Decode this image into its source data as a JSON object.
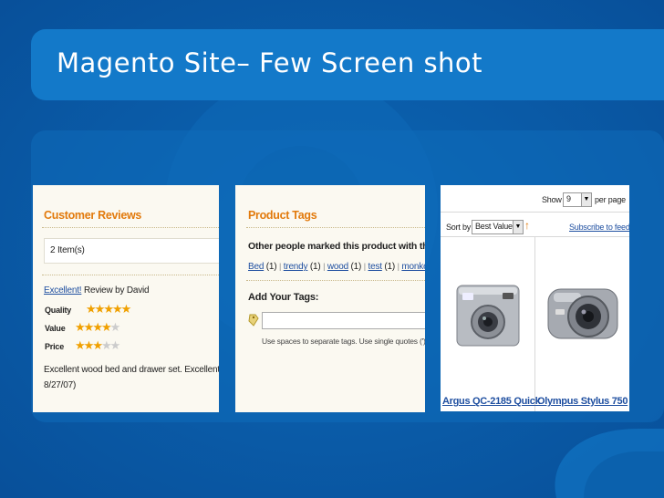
{
  "slide": {
    "title": "Magento Site– Few Screen shot",
    "colors": {
      "background": "#0a5ea8",
      "band": "#1379c9",
      "accent": "#e27a0c",
      "link": "#1f4fa0",
      "star": "#f0a000"
    }
  },
  "reviews_panel": {
    "heading": "Customer Reviews",
    "count": "2 Item(s)",
    "review_title": "Excellent!",
    "review_by": " Review by David",
    "ratings": [
      {
        "label": "Quality",
        "stars": 5,
        "max": 5
      },
      {
        "label": "Value",
        "stars": 4,
        "max": 5
      },
      {
        "label": "Price",
        "stars": 3,
        "max": 5
      }
    ],
    "body_line1": "Excellent wood bed and drawer set. Excellent value, f",
    "body_line2": "8/27/07)"
  },
  "tags_panel": {
    "heading": "Product Tags",
    "others_label": "Other people marked this product with these ta",
    "tags": [
      {
        "name": "Bed",
        "count": " (1)"
      },
      {
        "name": "trendy",
        "count": " (1)"
      },
      {
        "name": "wood",
        "count": " (1)"
      },
      {
        "name": "test",
        "count": " (1)"
      },
      {
        "name": "monkeybu",
        "count": ""
      }
    ],
    "add_label": "Add Your Tags:",
    "input_value": "",
    "hint": "Use spaces to separate tags. Use single quotes (') for p"
  },
  "products_panel": {
    "show_label": "Show",
    "show_value": "9",
    "per_page": "per page",
    "sort_label": "Sort by",
    "sort_value": "Best Value",
    "subscribe": "Subscribe to feed",
    "products": [
      {
        "name": "Argus QC-2185 Quick"
      },
      {
        "name": "Olympus Stylus 750"
      }
    ]
  }
}
